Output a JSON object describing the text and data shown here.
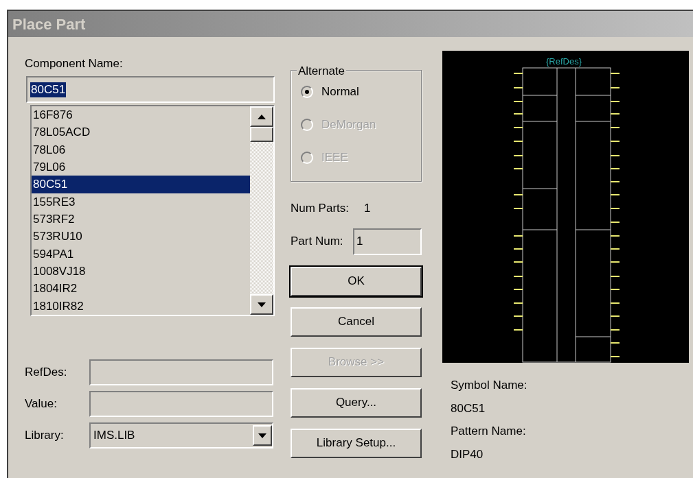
{
  "window": {
    "title": "Place Part"
  },
  "component_name": {
    "label": "Component Name:",
    "value": "80C51"
  },
  "parts_list": [
    {
      "name": "16F876",
      "selected": false
    },
    {
      "name": "78L05ACD",
      "selected": false
    },
    {
      "name": "78L06",
      "selected": false
    },
    {
      "name": "79L06",
      "selected": false
    },
    {
      "name": "80C51",
      "selected": true
    },
    {
      "name": "155RE3",
      "selected": false
    },
    {
      "name": "573RF2",
      "selected": false
    },
    {
      "name": "573RU10",
      "selected": false
    },
    {
      "name": "594PA1",
      "selected": false
    },
    {
      "name": "1008VJ18",
      "selected": false
    },
    {
      "name": "1804IR2",
      "selected": false
    },
    {
      "name": "1810IR82",
      "selected": false
    }
  ],
  "fields": [
    {
      "label": "RefDes:",
      "kind": "text"
    },
    {
      "label": "Value:",
      "kind": "text"
    },
    {
      "label": "Library:",
      "kind": "combo",
      "value": "IMS.LIB"
    }
  ],
  "alternate": {
    "title": "Alternate",
    "options": [
      {
        "label": "Normal",
        "selected": true,
        "disabled": false
      },
      {
        "label": "DeMorgan",
        "selected": false,
        "disabled": true
      },
      {
        "label": "IEEE",
        "selected": false,
        "disabled": true
      }
    ]
  },
  "num_parts": {
    "label": "Num Parts:",
    "value": "1"
  },
  "part_num": {
    "label": "Part Num:",
    "value": "1"
  },
  "buttons": [
    {
      "label": "OK",
      "default": true,
      "disabled": false
    },
    {
      "label": "Cancel",
      "default": false,
      "disabled": false
    },
    {
      "label": "Browse >>",
      "default": false,
      "disabled": true
    },
    {
      "label": "Query...",
      "default": false,
      "disabled": false
    },
    {
      "label": "Library Setup...",
      "default": false,
      "disabled": false
    }
  ],
  "preview": {
    "refdes": "{RefDes}"
  },
  "info": [
    {
      "label": "Symbol Name:",
      "value": "80C51"
    },
    {
      "label": "Pattern Name:",
      "value": "DIP40"
    }
  ]
}
